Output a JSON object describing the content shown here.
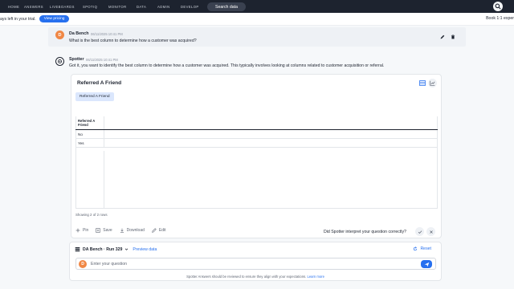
{
  "nav": {
    "items": [
      "HOME",
      "ANSWERS",
      "LIVEBOARDS",
      "SPOTIQ",
      "MONITOR",
      "DATA",
      "ADMIN",
      "DEVELOP"
    ],
    "search_label": "Search data"
  },
  "trial": {
    "text": "ays left in your trial.",
    "pricing_label": "View pricing",
    "book_text": "Book 1:1 exper"
  },
  "user_message": {
    "avatar_letter": "D",
    "name": "Da Bench",
    "time": "06/11/2025 10:41 PM",
    "text": "What is the best column to determine how a customer was acquired?"
  },
  "spotter_message": {
    "name": "Spotter",
    "time": "06/11/2025 10:41 PM",
    "text": "Got it, you want to identify the best column to determine how a customer was acquired. This typically involves looking at columns related to customer acquisition or referral."
  },
  "answer": {
    "title": "Referred A Friend",
    "chip": "Referred A Friend",
    "table": {
      "header": "Referred A Friend",
      "rows": [
        "No",
        "Yes"
      ]
    },
    "showing": "Showing 2 of 2 rows",
    "actions": {
      "pin": "Pin",
      "save": "Save",
      "download": "Download",
      "edit": "Edit"
    },
    "feedback_question": "Did Spotter interpret your question correctly?"
  },
  "composer": {
    "datasource": "DA Bench · Run 329",
    "preview_label": "Preview data",
    "reset_label": "Reset",
    "avatar_letter": "D",
    "placeholder": "Enter your question",
    "disclaimer": "Spotter Answers should be reviewed to ensure they align with your expectations.",
    "learn_more": "Learn more"
  },
  "colors": {
    "nav_bg": "#1d232f",
    "accent": "#2770ef",
    "avatar": "#f08745",
    "chip_bg": "#dbe7fd"
  }
}
